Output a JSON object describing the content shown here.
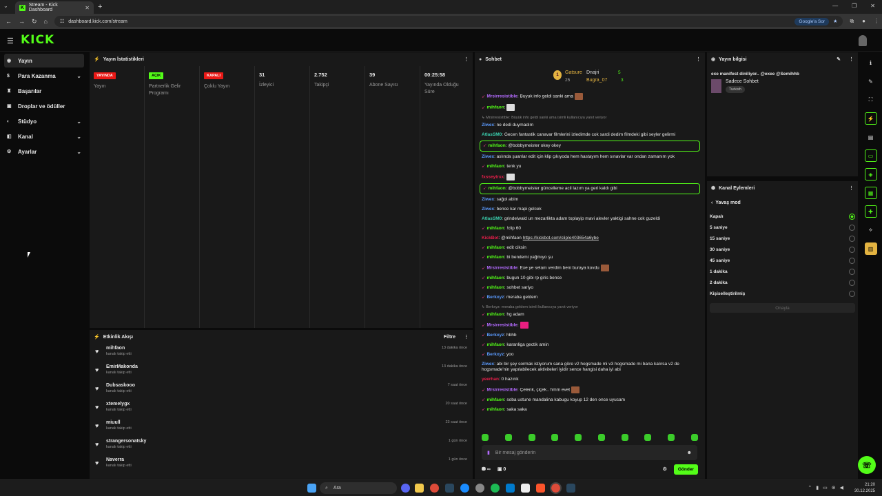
{
  "browser": {
    "tab_title": "Stream - Kick Dashboard",
    "url": "dashboard.kick.com/stream",
    "google_sor": "Google'a Sor"
  },
  "app": {
    "logo": "KICK"
  },
  "sidebar": {
    "items": [
      {
        "label": "Yayın",
        "icon": "broadcast-icon",
        "chevron": false
      },
      {
        "label": "Para Kazanma",
        "icon": "money-icon",
        "chevron": true
      },
      {
        "label": "Başarılar",
        "icon": "trophy-icon",
        "chevron": false
      },
      {
        "label": "Droplar ve ödüller",
        "icon": "gift-icon",
        "chevron": false
      },
      {
        "label": "Stüdyo",
        "icon": "studio-icon",
        "chevron": true
      },
      {
        "label": "Kanal",
        "icon": "channel-icon",
        "chevron": true
      },
      {
        "label": "Ayarlar",
        "icon": "settings-icon",
        "chevron": true
      }
    ]
  },
  "stats": {
    "title": "Yayın İstatistikleri",
    "cols": [
      {
        "badge": "YAYINDA",
        "badge_color": "red",
        "label": "Yayın"
      },
      {
        "badge": "AÇIK",
        "badge_color": "green",
        "label": "Partnerlik Gelir Programı"
      },
      {
        "badge": "KAPALI",
        "badge_color": "red",
        "label": "Çoklu Yayın"
      },
      {
        "value": "31",
        "label": "İzleyici"
      },
      {
        "value": "2.752",
        "label": "Takipçi"
      },
      {
        "value": "39",
        "label": "Abone Sayısı"
      },
      {
        "value": "00:25:58",
        "label": "Yayında Olduğu Süre"
      }
    ]
  },
  "activity": {
    "title": "Etkinlik Akışı",
    "filter": "Filtre",
    "rows": [
      {
        "name": "mihfaon",
        "sub": "kanalı takip etti",
        "time": "13 dakika önce"
      },
      {
        "name": "EmirMakonda",
        "sub": "kanalı takip etti",
        "time": "13 dakika önce"
      },
      {
        "name": "Dubsaskooo",
        "sub": "kanalı takip etti",
        "time": "7 saat önce"
      },
      {
        "name": "xtemelygx",
        "sub": "kanalı takip etti",
        "time": "20 saat önce"
      },
      {
        "name": "miuull",
        "sub": "kanalı takip etti",
        "time": "23 saat önce"
      },
      {
        "name": "strangersonatsky",
        "sub": "kanalı takip etti",
        "time": "1 gün önce"
      },
      {
        "name": "Naverra",
        "sub": "kanalı takip etti",
        "time": "1 gün önce"
      }
    ]
  },
  "chat": {
    "title": "Sohbet",
    "leader": {
      "name1": "Gatsure",
      "name1_sub": "25",
      "name2": "Dnajri",
      "name3": "Bugra_07",
      "count1": "5",
      "count2": "3"
    },
    "messages": [
      {
        "user": "Mrsirresistible",
        "color": "#b46bff",
        "text": ": Buyuk info geldi sanki ama",
        "pin": true,
        "emote": "brown"
      },
      {
        "user": "mihfaon",
        "color": "#53fc18",
        "text": ":",
        "pin": true,
        "emote": "white"
      },
      {
        "reply": "↳ Mrsirresistible: Büyük info geldi sanki ama  isimli kullanıcıya yanıt veriyor"
      },
      {
        "user": "Ziwex",
        "color": "#5b9bff",
        "text": ": ne dedi duymadım"
      },
      {
        "user": "AtlasSM0",
        "color": "#3bd1b0",
        "text": ": Gecen fantastik canavar filmlerini izledimde cok sardi dedim filmdeki gibi seyler gelirmi"
      },
      {
        "user": "mihfaon",
        "color": "#53fc18",
        "text": ": @bobbymeister okey okey",
        "pin": true,
        "highlight": true
      },
      {
        "user": "Ziwex",
        "color": "#5b9bff",
        "text": ": aslında şuanlar edit için klip çıkıyoda hem hastayım hem sınavlar var ondan zamanım yok"
      },
      {
        "user": "mihfaon",
        "color": "#53fc18",
        "text": ": tenk yu",
        "pin": true
      },
      {
        "user": "fxsseytrxx",
        "color": "#e91e4a",
        "text": ":",
        "emote": "white"
      },
      {
        "user": "mihfaon",
        "color": "#53fc18",
        "text": ": @bobbymeister güncelleme acil lazım ya geri kaldı gibi",
        "pin": true,
        "highlight": true
      },
      {
        "user": "Ziwex",
        "color": "#5b9bff",
        "text": ": sağol abim"
      },
      {
        "user": "Ziwex",
        "color": "#5b9bff",
        "text": ": bence kar mapi gelcek"
      },
      {
        "user": "AtlasSM0",
        "color": "#3bd1b0",
        "text": ": grindelwald un mezarlikta adam toplayip mavi alevler yaktigi sahne cok guzeldi"
      },
      {
        "user": "mihfaon",
        "color": "#53fc18",
        "text": ": !clip 60",
        "pin": true
      },
      {
        "user": "KickBot",
        "color": "#e91e4a",
        "text": ": @mihfaon ",
        "link": "https://kickbot.com/clip/e403654a6ybe"
      },
      {
        "user": "mihfaon",
        "color": "#53fc18",
        "text": ": edit ciksin",
        "pin": true
      },
      {
        "user": "mihfaon",
        "color": "#53fc18",
        "text": ": bi bendemi yağmıyo şu",
        "pin": true
      },
      {
        "user": "Mrsirresistible",
        "color": "#b46bff",
        "text": ": Exe ye selam verdim beni buraya kovdu",
        "pin": true,
        "emote": "brown"
      },
      {
        "user": "mihfaon",
        "color": "#53fc18",
        "text": ": bugun 10 gibi rp giris bence",
        "pin": true
      },
      {
        "user": "mihfaon",
        "color": "#53fc18",
        "text": ": sohbet sariyo",
        "pin": true
      },
      {
        "user": "Berkxyz",
        "color": "#5b9bff",
        "text": ": meraba geldem",
        "pin": true
      },
      {
        "reply": "↳ Berkxyz: meraba geldem isimli kullanıcıya yanıt veriyor"
      },
      {
        "user": "mihfaon",
        "color": "#53fc18",
        "text": ": hg adam",
        "pin": true
      },
      {
        "user": "Mrsirresistible",
        "color": "#b46bff",
        "text": ":",
        "pin": true,
        "emote": "pink"
      },
      {
        "user": "Berkxyz",
        "color": "#5b9bff",
        "text": ": hbhb",
        "pin": true
      },
      {
        "user": "mihfaon",
        "color": "#53fc18",
        "text": ": karanliga gectik amin",
        "pin": true
      },
      {
        "user": "Berkxyz",
        "color": "#5b9bff",
        "text": ": yoo",
        "pin": true
      },
      {
        "user": "Ziwex",
        "color": "#5b9bff",
        "text": ": abi bir şey sormak istiyorum sana göre v2 hogsmade mi v3 hogsmade mi bana kalırsa v2 de hogsmade'nin yapılabilecek aktiviteleri iyidir sence hangisi daha iyi abi"
      },
      {
        "user": "yeerhan",
        "color": "#e91e4a",
        "text": ": 0 hazırık"
      },
      {
        "user": "Mrsirresistible",
        "color": "#b46bff",
        "text": ": Çelenk, çiçek.. hmm evet",
        "pin": true,
        "emote": "brown"
      },
      {
        "user": "mihfaon",
        "color": "#53fc18",
        "text": ": soba ustune mandalina kabugu koyup 12 den once uyucam",
        "pin": true
      },
      {
        "user": "mihfaon",
        "color": "#53fc18",
        "text": ": saka saka",
        "pin": true
      }
    ],
    "input_placeholder": "Bir mesaj gönderin",
    "footer_left": "∞",
    "footer_count": "0",
    "send": "Gönder"
  },
  "info": {
    "title": "Yayın bilgisi",
    "stream_title": "exe manifest diniliyor.. @exee @Semihhb",
    "category": "Sadece Sohbet",
    "language": "Turkish"
  },
  "actions": {
    "title": "Kanal Eylemleri",
    "mode": "Yavaş mod",
    "options": [
      {
        "label": "Kapalı",
        "selected": true
      },
      {
        "label": "5 saniye",
        "selected": false
      },
      {
        "label": "15 saniye",
        "selected": false
      },
      {
        "label": "30 saniye",
        "selected": false
      },
      {
        "label": "45 saniye",
        "selected": false
      },
      {
        "label": "1 dakika",
        "selected": false
      },
      {
        "label": "2 dakika",
        "selected": false
      },
      {
        "label": "Kişiselleştirilmiş",
        "selected": false
      }
    ],
    "apply": "Onayla"
  },
  "taskbar": {
    "search": "Ara",
    "time": "21:20",
    "date": "30.12.2025"
  },
  "colors": {
    "accent": "#53fc18",
    "live": "#e91916",
    "panel": "#191919",
    "bg": "#0b0b0b"
  }
}
